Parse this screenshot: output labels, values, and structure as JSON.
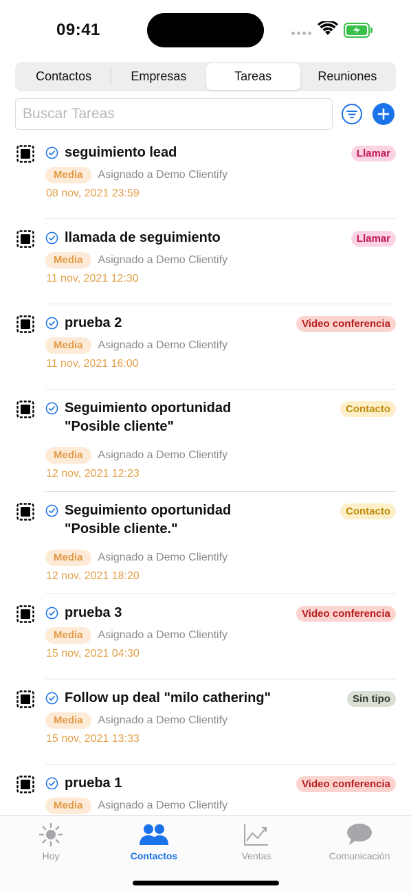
{
  "status_bar": {
    "time": "09:41",
    "icons": [
      "signal-dots-icon",
      "wifi-icon",
      "battery-charging-icon"
    ]
  },
  "segments": [
    {
      "label": "Contactos",
      "active": false
    },
    {
      "label": "Empresas",
      "active": false
    },
    {
      "label": "Tareas",
      "active": true
    },
    {
      "label": "Reuniones",
      "active": false
    }
  ],
  "search": {
    "placeholder": "Buscar Tareas",
    "value": ""
  },
  "actions": {
    "filter_icon": "filter-icon",
    "add_icon": "plus-icon"
  },
  "colors": {
    "accent": "#1a73e8",
    "priority_bg": "#fdebd8",
    "priority_text": "#e39b47",
    "date_text": "#e3a048"
  },
  "tasks": [
    {
      "title": "seguimiento lead",
      "type": "Llamar",
      "type_style": "llamar",
      "priority": "Media",
      "assigned": "Asignado a Demo Clientify",
      "date": "08 nov, 2021 23:59"
    },
    {
      "title": "llamada de seguimiento",
      "type": "Llamar",
      "type_style": "llamar",
      "priority": "Media",
      "assigned": "Asignado a Demo Clientify",
      "date": "11 nov, 2021 12:30"
    },
    {
      "title": "prueba 2",
      "type": "Video conferencia",
      "type_style": "video",
      "priority": "Media",
      "assigned": "Asignado a Demo Clientify",
      "date": "11 nov, 2021 16:00"
    },
    {
      "title": "Seguimiento oportunidad \"Posible cliente\"",
      "type": "Contacto",
      "type_style": "contacto",
      "priority": "Media",
      "assigned": "Asignado a Demo Clientify",
      "date": "12 nov, 2021 12:23"
    },
    {
      "title": "Seguimiento oportunidad \"Posible cliente.\"",
      "type": "Contacto",
      "type_style": "contacto",
      "priority": "Media",
      "assigned": "Asignado a Demo Clientify",
      "date": "12 nov, 2021 18:20"
    },
    {
      "title": "prueba 3",
      "type": "Video conferencia",
      "type_style": "video",
      "priority": "Media",
      "assigned": "Asignado a Demo Clientify",
      "date": "15 nov, 2021 04:30"
    },
    {
      "title": "Follow up deal \"milo cathering\"",
      "type": "Sin tipo",
      "type_style": "sintipo",
      "priority": "Media",
      "assigned": "Asignado a Demo Clientify",
      "date": "15 nov, 2021 13:33"
    },
    {
      "title": "prueba 1",
      "type": "Video conferencia",
      "type_style": "video",
      "priority": "Media",
      "assigned": "Asignado a Demo Clientify",
      "date": ""
    }
  ],
  "tab_bar": [
    {
      "label": "Hoy",
      "icon": "sun-icon",
      "active": false
    },
    {
      "label": "Contactos",
      "icon": "people-icon",
      "active": true
    },
    {
      "label": "Ventas",
      "icon": "chart-line-icon",
      "active": false
    },
    {
      "label": "Comunicación",
      "icon": "chat-bubble-icon",
      "active": false
    }
  ]
}
